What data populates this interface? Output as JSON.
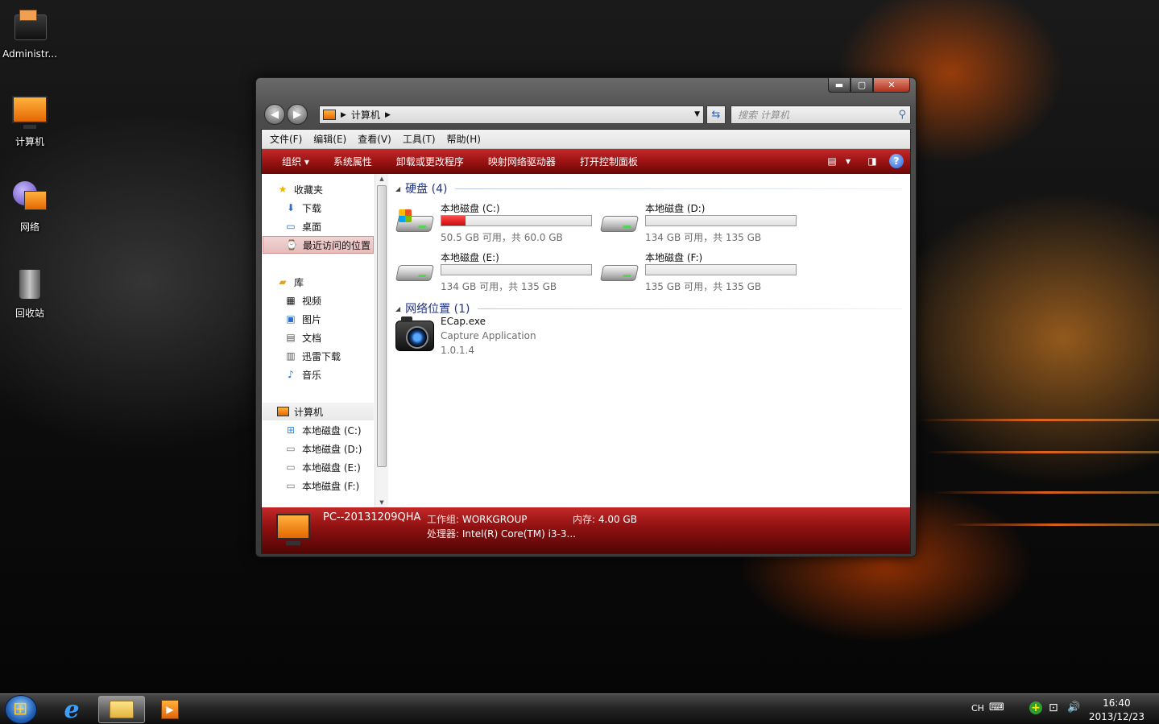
{
  "desktop": {
    "icons": [
      {
        "label": "Administr...",
        "icon": "user-folder-icon"
      },
      {
        "label": "计算机",
        "icon": "computer-icon"
      },
      {
        "label": "网络",
        "icon": "network-icon"
      },
      {
        "label": "回收站",
        "icon": "recycle-bin-icon"
      }
    ]
  },
  "window": {
    "controls": {
      "minimize": "▬",
      "maximize": "▢",
      "close": "✕"
    },
    "nav": {
      "back": "◀",
      "forward": "▶"
    },
    "address": {
      "location": "计算机",
      "separator": "▶"
    },
    "search": {
      "placeholder": "搜索 计算机"
    },
    "menu": [
      "文件(F)",
      "编辑(E)",
      "查看(V)",
      "工具(T)",
      "帮助(H)"
    ],
    "toolbar": {
      "organize": "组织 ▾",
      "items": [
        "系统属性",
        "卸载或更改程序",
        "映射网络驱动器",
        "打开控制面板"
      ],
      "help": "?"
    },
    "nav_pane": {
      "favorites": {
        "label": "收藏夹",
        "items": [
          "下载",
          "桌面",
          "最近访问的位置"
        ],
        "selected": "最近访问的位置"
      },
      "libraries": {
        "label": "库",
        "items": [
          "视频",
          "图片",
          "文档",
          "迅雷下载",
          "音乐"
        ]
      },
      "computer": {
        "label": "计算机",
        "items": [
          "本地磁盘 (C:)",
          "本地磁盘 (D:)",
          "本地磁盘 (E:)",
          "本地磁盘 (F:)"
        ]
      }
    },
    "groups": {
      "drives_header": "硬盘 (4)",
      "network_header": "网络位置 (1)"
    },
    "drives": [
      {
        "name": "本地磁盘 (C:)",
        "free": "50.5 GB 可用，共 60.0 GB",
        "used_fraction": 0.16,
        "system": true
      },
      {
        "name": "本地磁盘 (D:)",
        "free": "134 GB 可用，共 135 GB",
        "used_fraction": 0.0,
        "system": false
      },
      {
        "name": "本地磁盘 (E:)",
        "free": "134 GB 可用，共 135 GB",
        "used_fraction": 0.0,
        "system": false
      },
      {
        "name": "本地磁盘 (F:)",
        "free": "135 GB 可用，共 135 GB",
        "used_fraction": 0.0,
        "system": false
      }
    ],
    "network_item": {
      "name": "ECap.exe",
      "description": "Capture Application",
      "version": "1.0.1.4"
    },
    "details": {
      "pc_name": "PC--20131209QHA",
      "workgroup_label": "工作组:",
      "workgroup": "WORKGROUP",
      "memory_label": "内存:",
      "memory": "4.00 GB",
      "cpu_label": "处理器:",
      "cpu": "Intel(R) Core(TM) i3-3..."
    }
  },
  "taskbar": {
    "apps": [
      {
        "name": "internet-explorer",
        "glyph": "e"
      },
      {
        "name": "windows-explorer",
        "active": true
      },
      {
        "name": "media-player",
        "glyph": "▶"
      }
    ],
    "tray": {
      "lang": "CH",
      "keyboard": "⌨",
      "plus": "+",
      "network": "⊡",
      "volume": "🔊"
    },
    "clock": {
      "time": "16:40",
      "date": "2013/12/23"
    }
  }
}
